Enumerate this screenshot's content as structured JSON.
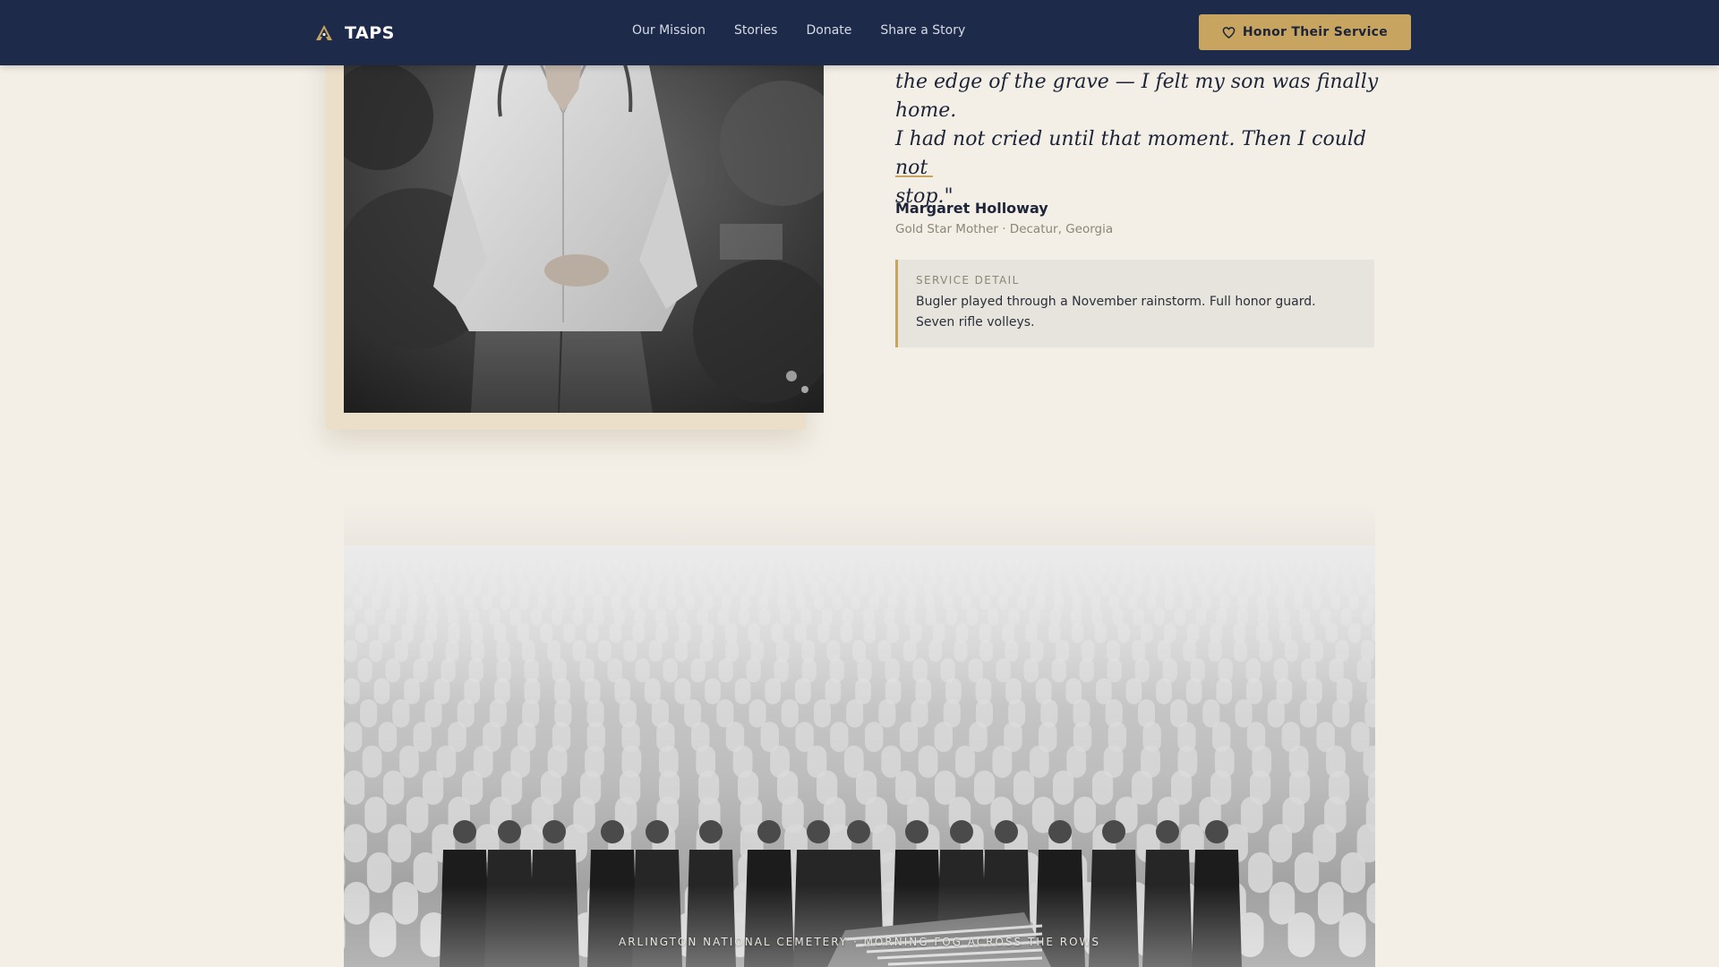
{
  "nav": {
    "brand": "TAPS",
    "links": [
      "Our Mission",
      "Stories",
      "Donate",
      "Share a Story"
    ],
    "cta_label": "Honor Their Service",
    "colors": {
      "background": "#1d2a49",
      "accent": "#c8a461"
    }
  },
  "story": {
    "quote_lines": [
      "the edge of the grave — I felt my son was finally home.",
      "I had not cried until that moment. Then I could not",
      "stop.\""
    ],
    "author_name": "Margaret Holloway",
    "author_meta": "Gold Star Mother · Decatur, Georgia",
    "service_detail": {
      "label": "SERVICE DETAIL",
      "text": "Bugler played through a November rainstorm. Full honor guard. Seven rifle volleys."
    }
  },
  "gallery": {
    "caption": "ARLINGTON NATIONAL CEMETERY · MORNING FOG ACROSS THE ROWS"
  },
  "icons": [
    "taps-logo-icon",
    "heart-icon"
  ],
  "colors": {
    "page_bg": "#f3efe7",
    "text": "#1d2438",
    "muted": "#8a8678"
  }
}
